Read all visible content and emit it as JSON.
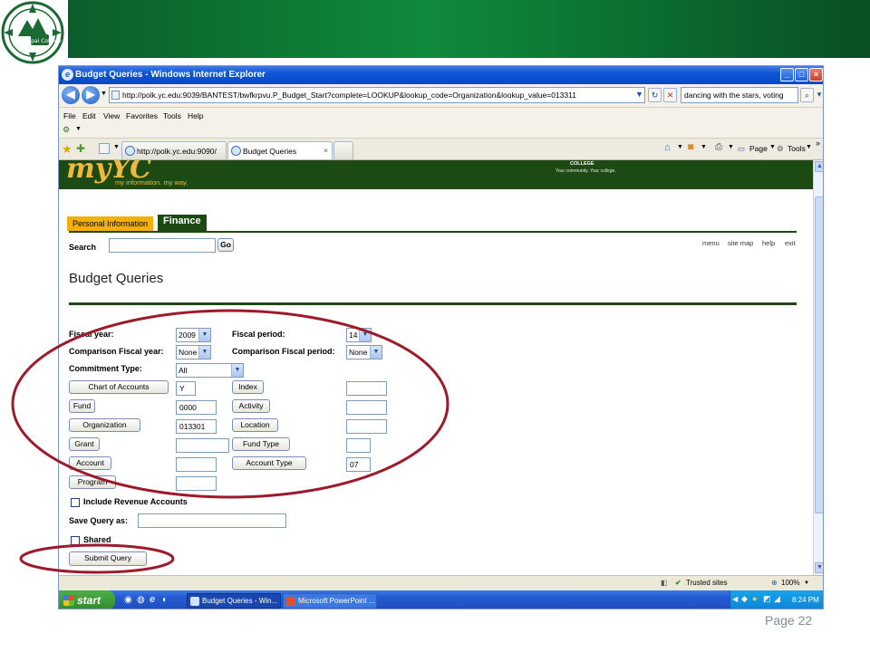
{
  "slide": {
    "page_number": "Page 22",
    "logo_text": "Yavapai College"
  },
  "browser": {
    "title": "Budget Queries - Windows Internet Explorer",
    "address": "http://polk.yc.edu:9039/BANTEST/bwfkrpvu.P_Budget_Start?complete=LOOKUP&lookup_code=Organization&lookup_value=013311",
    "search_query": "dancing with the stars, voting",
    "menu": [
      "File",
      "Edit",
      "View",
      "Favorites",
      "Tools",
      "Help"
    ],
    "tabs": [
      {
        "label": "http://polk.yc.edu:9090/"
      },
      {
        "label": "Budget Queries"
      }
    ],
    "toolbar": {
      "page_label": "Page",
      "tools_label": "Tools"
    },
    "status": {
      "zone": "Trusted sites",
      "zoom": "100%"
    }
  },
  "site": {
    "logo": "myYC",
    "tagline": "my information. my way.",
    "college_name": "COLLEGE",
    "college_tagline": "Your community. Your college.",
    "tab_personal": "Personal Information",
    "tab_finance": "Finance",
    "search_label": "Search",
    "go_label": "Go",
    "top_links": [
      "menu",
      "site map",
      "help",
      "exit"
    ],
    "page_title": "Budget Queries"
  },
  "form": {
    "fiscal_year_label": "Fiscal year:",
    "fiscal_year_value": "2009",
    "fiscal_period_label": "Fiscal period:",
    "fiscal_period_value": "14",
    "comp_fiscal_year_label": "Comparison Fiscal year:",
    "comp_fiscal_year_value": "None",
    "comp_fiscal_period_label": "Comparison Fiscal period:",
    "comp_fiscal_period_value": "None",
    "commitment_type_label": "Commitment Type:",
    "commitment_type_value": "All",
    "chart_of_accounts_btn": "Chart of Accounts",
    "chart_of_accounts_value": "Y",
    "index_btn": "Index",
    "fund_btn": "Fund",
    "fund_value": "0000",
    "activity_btn": "Activity",
    "organization_btn": "Organization",
    "organization_value": "013301",
    "location_btn": "Location",
    "grant_btn": "Grant",
    "fund_type_btn": "Fund Type",
    "account_btn": "Account",
    "account_type_btn": "Account Type",
    "account_type_value": "07",
    "program_btn": "Program",
    "include_revenue_label": "Include Revenue Accounts",
    "save_query_label": "Save Query as:",
    "shared_label": "Shared",
    "submit_label": "Submit Query"
  },
  "taskbar": {
    "start_label": "start",
    "tasks": [
      "Budget Queries - Win...",
      "Microsoft PowerPoint ..."
    ],
    "clock": "8:24 PM"
  },
  "colors": {
    "banner_green": "#0f8a3c",
    "yc_green": "#1d4a12",
    "yc_gold": "#f1b93b",
    "annotation_red": "#9e1a2a"
  }
}
